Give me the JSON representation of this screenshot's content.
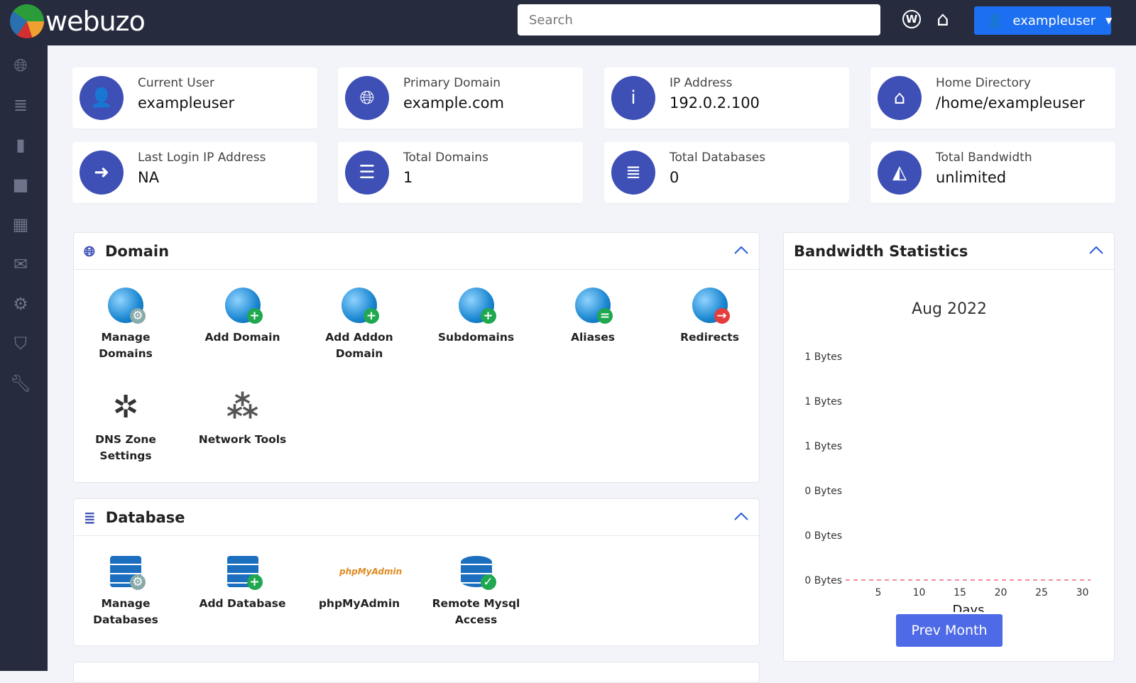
{
  "header": {
    "logo_text": "webuzo",
    "search_placeholder": "Search",
    "username": "exampleuser"
  },
  "sidebar": {
    "items": [
      "globe-icon",
      "database-icon",
      "file-icon",
      "folder-icon",
      "apps-icon",
      "mail-icon",
      "gears-icon",
      "shield-icon",
      "wrench-icon"
    ]
  },
  "cards": [
    {
      "label": "Current User",
      "value": "exampleuser",
      "icon": "user-icon"
    },
    {
      "label": "Primary Domain",
      "value": "example.com",
      "icon": "globe-icon"
    },
    {
      "label": "IP Address",
      "value": "192.0.2.100",
      "icon": "info-icon"
    },
    {
      "label": "Home Directory",
      "value": "/home/exampleuser",
      "icon": "home-icon"
    },
    {
      "label": "Last Login IP Address",
      "value": "NA",
      "icon": "sign-in-icon"
    },
    {
      "label": "Total Domains",
      "value": "1",
      "icon": "list-icon"
    },
    {
      "label": "Total Databases",
      "value": "0",
      "icon": "database-icon"
    },
    {
      "label": "Total Bandwidth",
      "value": "unlimited",
      "icon": "area-chart-icon"
    }
  ],
  "domain": {
    "title": "Domain",
    "tools": [
      "Manage Domains",
      "Add Domain",
      "Add Addon Domain",
      "Subdomains",
      "Aliases",
      "Redirects",
      "DNS Zone Settings",
      "Network Tools"
    ]
  },
  "database": {
    "title": "Database",
    "tools": [
      "Manage Databases",
      "Add Database",
      "phpMyAdmin",
      "Remote Mysql Access"
    ]
  },
  "bandwidth": {
    "title": "Bandwidth Statistics",
    "prev_month": "Prev Month"
  },
  "chart_data": {
    "type": "line",
    "title": "Aug 2022",
    "xlabel": "Days",
    "ylabel": "",
    "x_ticks": [
      "5",
      "10",
      "15",
      "20",
      "25",
      "30"
    ],
    "y_ticks": [
      "1 Bytes",
      "1 Bytes",
      "1 Bytes",
      "0 Bytes",
      "0 Bytes",
      "0 Bytes"
    ],
    "x": [
      1,
      2,
      3,
      4,
      5,
      6,
      7,
      8,
      9,
      10,
      11,
      12,
      13,
      14,
      15,
      16,
      17,
      18,
      19,
      20,
      21,
      22,
      23,
      24,
      25,
      26,
      27,
      28,
      29,
      30,
      31
    ],
    "values": [
      0,
      0,
      0,
      0,
      0,
      0,
      0,
      0,
      0,
      0,
      0,
      0,
      0,
      0,
      0,
      0,
      0,
      0,
      0,
      0,
      0,
      0,
      0,
      0,
      0,
      0,
      0,
      0,
      0,
      0,
      0
    ],
    "xlim": [
      1,
      31
    ],
    "line_color": "#f06080",
    "line_style": "dashed"
  }
}
